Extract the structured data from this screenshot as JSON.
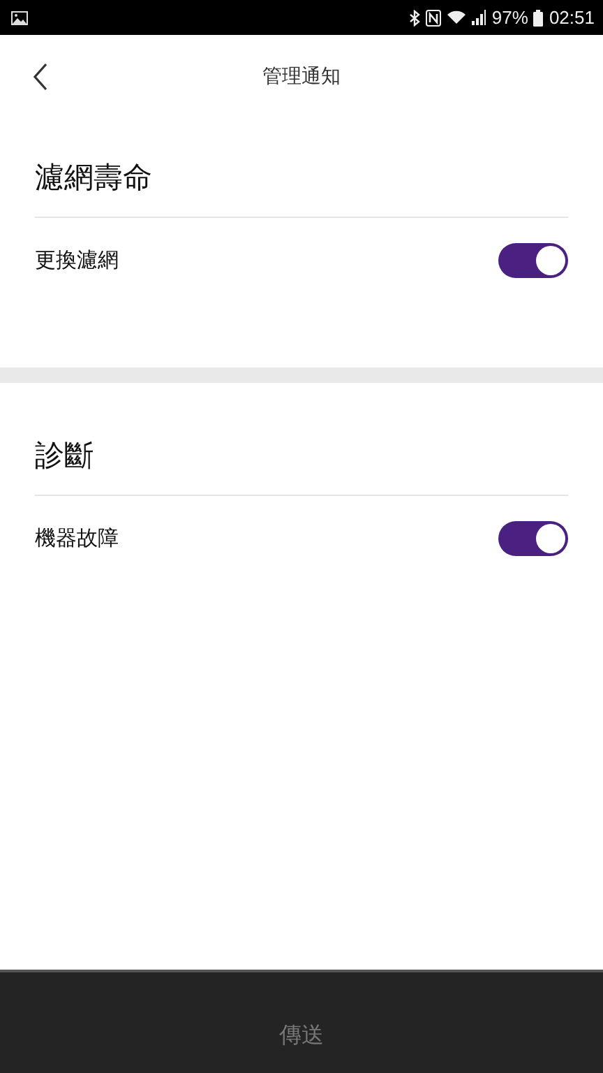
{
  "status_bar": {
    "battery": "97%",
    "time": "02:51"
  },
  "header": {
    "title": "管理通知"
  },
  "sections": [
    {
      "title": "濾網壽命",
      "items": [
        {
          "label": "更換濾網",
          "on": true
        }
      ]
    },
    {
      "title": "診斷",
      "items": [
        {
          "label": "機器故障",
          "on": true
        }
      ]
    }
  ],
  "send_button": {
    "label": "傳送",
    "disabled": true
  }
}
